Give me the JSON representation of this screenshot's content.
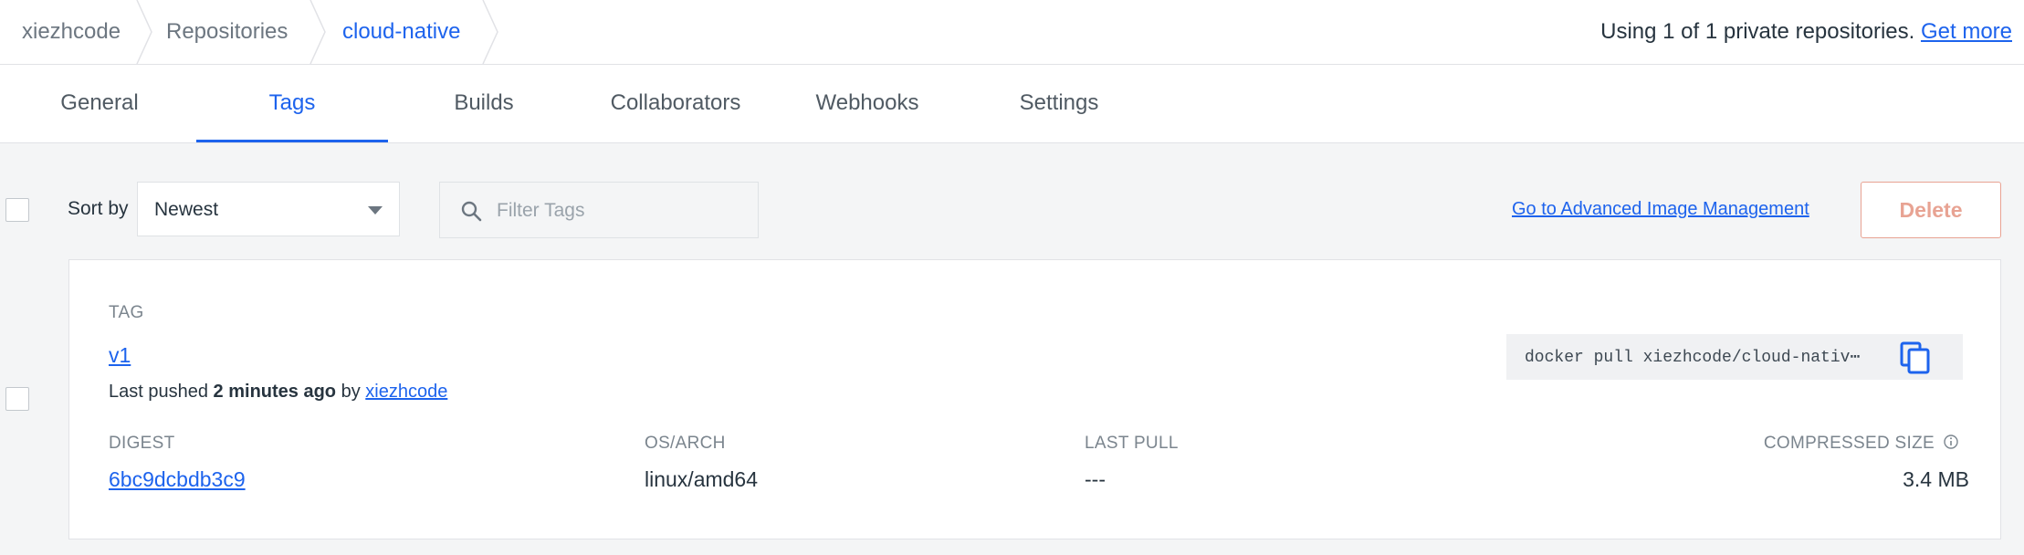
{
  "breadcrumb": {
    "items": [
      "xiezhcode",
      "Repositories",
      "cloud-native"
    ]
  },
  "quota": {
    "text": "Using 1 of 1 private repositories.",
    "link": "Get more"
  },
  "tabs": [
    "General",
    "Tags",
    "Builds",
    "Collaborators",
    "Webhooks",
    "Settings"
  ],
  "active_tab": "Tags",
  "controls": {
    "sort_label": "Sort by",
    "sort_value": "Newest",
    "filter_placeholder": "Filter Tags",
    "advanced_link": "Go to Advanced Image Management",
    "delete_label": "Delete"
  },
  "tag": {
    "header": "TAG",
    "name": "v1",
    "pushed_prefix": "Last pushed",
    "pushed_time": "2 minutes ago",
    "pushed_by": "by",
    "pushed_user": "xiezhcode",
    "pull_command": "docker pull xiezhcode/cloud-nativ⋯",
    "columns": {
      "digest": "DIGEST",
      "os_arch": "OS/ARCH",
      "last_pull": "LAST PULL",
      "compressed_size": "COMPRESSED SIZE"
    },
    "values": {
      "digest": "6bc9dcbdb3c9",
      "os_arch": "linux/amd64",
      "last_pull": "---",
      "compressed_size": "3.4 MB"
    }
  },
  "colors": {
    "accent": "#1d63ed",
    "delete": "#e8a393",
    "background": "#f4f5f6"
  },
  "icons": [
    "chevron-separator-icon",
    "search-icon",
    "chevron-down-icon",
    "copy-icon",
    "info-icon"
  ]
}
